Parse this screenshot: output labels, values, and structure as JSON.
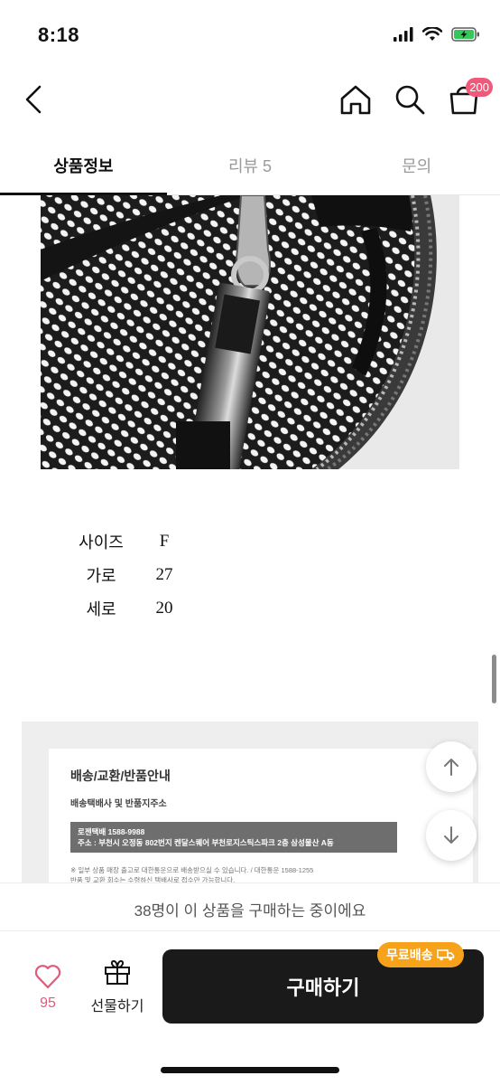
{
  "status_bar": {
    "time": "8:18"
  },
  "header": {
    "cart_badge": "200"
  },
  "tabs": [
    {
      "label": "상품정보",
      "active": true
    },
    {
      "label": "리뷰 5",
      "active": false
    },
    {
      "label": "문의",
      "active": false
    }
  ],
  "size_table": [
    {
      "label": "사이즈",
      "value": "F"
    },
    {
      "label": "가로",
      "value": "27"
    },
    {
      "label": "세로",
      "value": "20"
    }
  ],
  "shipping_info": {
    "title": "배송/교환/반품안내",
    "subtitle": "배송택배사 및 반품지주소",
    "courier_line": "로젠택배 1588-9988",
    "address_line": "주소 : 부천시 오정동 802번지 켄달스퀘어 부천로지스틱스파크 2층 삼성물산 A동",
    "note_line1": "※ 일부 상품 매장 출고로 대한통운으로 배송받으실 수 있습니다. / 대한통운 1588-1255",
    "note_line2": "반품 및 교환 회수는 수령하신 택배사로 접수만 가능합니다."
  },
  "buying_banner": "38명이 이 상품을 구매하는 중이에요",
  "bottom_bar": {
    "like_count": "95",
    "gift_label": "선물하기",
    "buy_label": "구매하기",
    "free_shipping_badge": "무료배송"
  },
  "colors": {
    "accent_pink": "#ef5a7a",
    "badge_orange": "#f7a21b",
    "buy_button": "#1a1a1a"
  }
}
